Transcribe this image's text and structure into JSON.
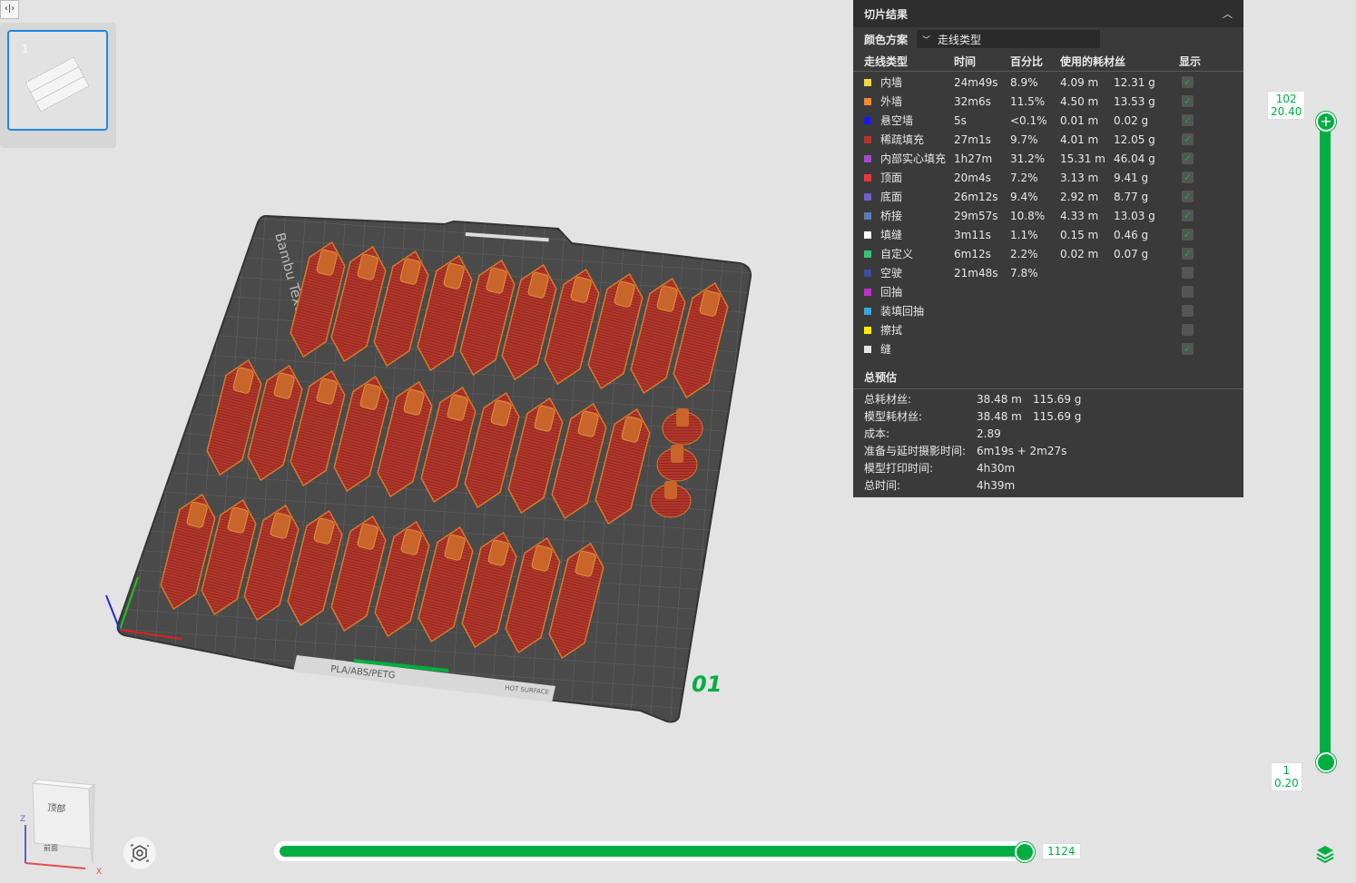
{
  "toolbar": {
    "toggle_glyph": "‹|›"
  },
  "plate_list": {
    "items": [
      {
        "number": "1"
      }
    ]
  },
  "panel": {
    "title": "切片结果",
    "collapse_glyph": "︿",
    "scheme_label": "颜色方案",
    "scheme_value": "走线类型",
    "columns": [
      "走线类型",
      "时间",
      "百分比",
      "使用的耗材丝",
      "",
      "显示"
    ],
    "rows": [
      {
        "name": "内墙",
        "color": "#f5d742",
        "time": "24m49s",
        "percent": "8.9%",
        "length": "4.09 m",
        "weight": "12.31 g",
        "shown": true
      },
      {
        "name": "外墙",
        "color": "#f28a2e",
        "time": "32m6s",
        "percent": "11.5%",
        "length": "4.50 m",
        "weight": "13.53 g",
        "shown": true
      },
      {
        "name": "悬空墙",
        "color": "#1a1ae6",
        "time": "5s",
        "percent": "<0.1%",
        "length": "0.01 m",
        "weight": "0.02 g",
        "shown": true
      },
      {
        "name": "稀疏填充",
        "color": "#b3362b",
        "time": "27m1s",
        "percent": "9.7%",
        "length": "4.01 m",
        "weight": "12.05 g",
        "shown": true
      },
      {
        "name": "内部实心填充",
        "color": "#a54bc9",
        "time": "1h27m",
        "percent": "31.2%",
        "length": "15.31 m",
        "weight": "46.04 g",
        "shown": true
      },
      {
        "name": "顶面",
        "color": "#e8373c",
        "time": "20m4s",
        "percent": "7.2%",
        "length": "3.13 m",
        "weight": "9.41 g",
        "shown": true
      },
      {
        "name": "底面",
        "color": "#7060d0",
        "time": "26m12s",
        "percent": "9.4%",
        "length": "2.92 m",
        "weight": "8.77 g",
        "shown": true
      },
      {
        "name": "桥接",
        "color": "#5a7ab8",
        "time": "29m57s",
        "percent": "10.8%",
        "length": "4.33 m",
        "weight": "13.03 g",
        "shown": true
      },
      {
        "name": "填缝",
        "color": "#ffffff",
        "time": "3m11s",
        "percent": "1.1%",
        "length": "0.15 m",
        "weight": "0.46 g",
        "shown": true
      },
      {
        "name": "自定义",
        "color": "#36c47a",
        "time": "6m12s",
        "percent": "2.2%",
        "length": "0.02 m",
        "weight": "0.07 g",
        "shown": true
      },
      {
        "name": "空驶",
        "color": "#3c4ea0",
        "time": "21m48s",
        "percent": "7.8%",
        "length": "",
        "weight": "",
        "shown": false
      },
      {
        "name": "回抽",
        "color": "#c030c8",
        "time": "",
        "percent": "",
        "length": "",
        "weight": "",
        "shown": false
      },
      {
        "name": "装填回抽",
        "color": "#38a8d8",
        "time": "",
        "percent": "",
        "length": "",
        "weight": "",
        "shown": false
      },
      {
        "name": "擦拭",
        "color": "#ffee00",
        "time": "",
        "percent": "",
        "length": "",
        "weight": "",
        "shown": false
      },
      {
        "name": "缝",
        "color": "#e6e6e6",
        "time": "",
        "percent": "",
        "length": "",
        "weight": "",
        "shown": true
      }
    ],
    "estimate_title": "总预估",
    "estimates": [
      {
        "label": "总耗材丝:",
        "v1": "38.48 m",
        "v2": "115.69 g"
      },
      {
        "label": "模型耗材丝:",
        "v1": "38.48 m",
        "v2": "115.69 g"
      },
      {
        "label": "成本:",
        "v1": "2.89",
        "v2": ""
      },
      {
        "label": "准备与延时摄影时间:",
        "v1": "6m19s + 2m27s",
        "v2": ""
      },
      {
        "label": "模型打印时间:",
        "v1": "4h30m",
        "v2": ""
      },
      {
        "label": "总时间:",
        "v1": "4h39m",
        "v2": ""
      }
    ]
  },
  "layer_slider": {
    "top_layer": "102",
    "top_height": "20.40",
    "bottom_layer": "1",
    "bottom_height": "0.20"
  },
  "move_slider": {
    "value": "1124"
  },
  "plate": {
    "number_label": "01",
    "brand_text": "Bambu Textured",
    "material_text": "PLA/ABS/PETG",
    "hot_text": "HOT SURFACE"
  },
  "view_cube": {
    "top_face": "顶部",
    "front_face": "前面",
    "axis_x": "X",
    "axis_z": "Z"
  },
  "colors": {
    "accent": "#00ae42",
    "panel_bg": "#3a3a3a",
    "model_red": "#b3362b",
    "plate_dark": "#4a4a4a"
  }
}
